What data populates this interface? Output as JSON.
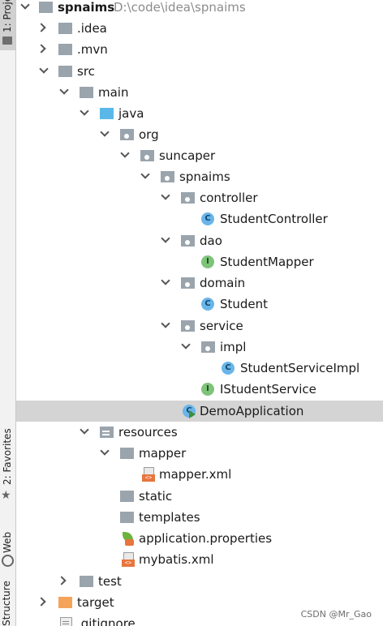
{
  "side_tabs": {
    "project": "1: Project",
    "favorites": "2: Favorites",
    "web": "Web",
    "structure": "Structure"
  },
  "tree": {
    "root_name": "spnaims",
    "root_path": "D:\\code\\idea\\spnaims",
    "idea": ".idea",
    "mvn": ".mvn",
    "src": "src",
    "main": "main",
    "java": "java",
    "org": "org",
    "suncaper": "suncaper",
    "spnaims": "spnaims",
    "controller": "controller",
    "student_controller": "StudentController",
    "dao": "dao",
    "student_mapper": "StudentMapper",
    "domain": "domain",
    "student": "Student",
    "service": "service",
    "impl": "impl",
    "student_service_impl": "StudentServiceImpl",
    "istudent_service": "IStudentService",
    "demo_application": "DemoApplication",
    "resources": "resources",
    "mapper": "mapper",
    "mapper_xml": "mapper.xml",
    "static": "static",
    "templates": "templates",
    "application_properties": "application.properties",
    "mybatis_xml": "mybatis.xml",
    "test": "test",
    "target": "target",
    "gitignore": ".gitignore"
  },
  "icons": {
    "class_icon_letter": "C",
    "interface_icon_letter": "I"
  },
  "watermark": "CSDN @Mr_Gao"
}
